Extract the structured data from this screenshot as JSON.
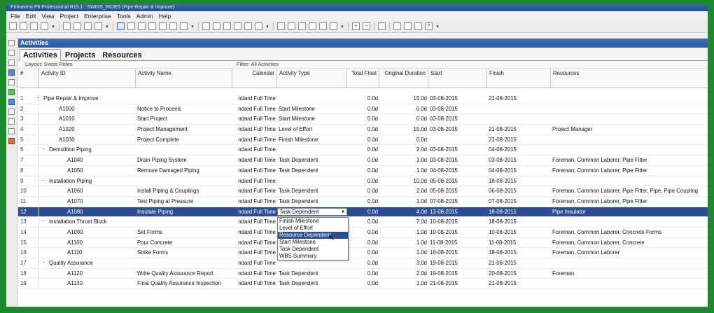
{
  "window": {
    "title": "Primavera P6 Professional R15.1 : SWISS_RIDES (Pipe Repair & Improve)"
  },
  "menu": [
    "File",
    "Edit",
    "View",
    "Project",
    "Enterprise",
    "Tools",
    "Admin",
    "Help"
  ],
  "panel_title": "Activities",
  "tabs": [
    "Activities",
    "Projects",
    "Resources"
  ],
  "layout_label": "Layout: Swiss Rides",
  "filter_label": "Filter: All Activities",
  "columns": {
    "num": "#",
    "id": "Activity ID",
    "name": "Activity Name",
    "calendar": "Calendar",
    "type": "Activity Type",
    "float": "Total Float",
    "duration": "Original Duration",
    "start": "Start",
    "finish": "Finish",
    "resources": "Resources"
  },
  "rows": [
    {
      "num": "1",
      "toggle": "−",
      "id": "Pipe Repair & Improve",
      "name": "",
      "calendar": "ndard Full Time",
      "type": "",
      "float": "0.0d",
      "duration": "15.0d",
      "start": "03-08-2015",
      "finish": "21-08-2015",
      "resources": ""
    },
    {
      "num": "2",
      "toggle": "",
      "id": "A1000",
      "name": "Notice to Proceed",
      "calendar": "ndard Full Time",
      "type": "Start Milestone",
      "float": "0.0d",
      "duration": "0.0d",
      "start": "03-08-2015",
      "finish": "",
      "resources": ""
    },
    {
      "num": "3",
      "toggle": "",
      "id": "A1010",
      "name": "Start Project",
      "calendar": "ndard Full Time",
      "type": "Start Milestone",
      "float": "0.0d",
      "duration": "0.0d",
      "start": "03-08-2015",
      "finish": "",
      "resources": ""
    },
    {
      "num": "4",
      "toggle": "",
      "id": "A1020",
      "name": "Project Management",
      "calendar": "ndard Full Time",
      "type": "Level of Effort",
      "float": "0.0d",
      "duration": "15.0d",
      "start": "03-08-2015",
      "finish": "21-08-2015",
      "resources": "Project Manager"
    },
    {
      "num": "5",
      "toggle": "",
      "id": "A1030",
      "name": "Project Complete",
      "calendar": "ndard Full Time",
      "type": "Finish Milestone",
      "float": "0.0d",
      "duration": "0.0d",
      "start": "",
      "finish": "21-08-2015",
      "resources": ""
    },
    {
      "num": "6",
      "toggle": "−",
      "id": "Demolition Piping",
      "name": "",
      "calendar": "ndard Full Time",
      "type": "",
      "float": "0.0d",
      "duration": "2.0d",
      "start": "03-08-2015",
      "finish": "04-08-2015",
      "resources": ""
    },
    {
      "num": "7",
      "toggle": "",
      "id": "A1040",
      "name": "Drain Piping System",
      "calendar": "ndard Full Time",
      "type": "Task Dependent",
      "float": "0.0d",
      "duration": "1.0d",
      "start": "03-08-2015",
      "finish": "03-08-2015",
      "resources": "Foreman, Common Laborer, Pipe Fitter"
    },
    {
      "num": "8",
      "toggle": "",
      "id": "A1050",
      "name": "Remove Damaged Piping",
      "calendar": "ndard Full Time",
      "type": "Task Dependent",
      "float": "0.0d",
      "duration": "1.0d",
      "start": "04-08-2015",
      "finish": "04-08-2015",
      "resources": "Foreman, Common Laborer, Pipe Fitter"
    },
    {
      "num": "9",
      "toggle": "−",
      "id": "Installation Piping",
      "name": "",
      "calendar": "ndard Full Time",
      "type": "",
      "float": "0.0d",
      "duration": "10.0d",
      "start": "05-08-2015",
      "finish": "18-08-2015",
      "resources": ""
    },
    {
      "num": "10",
      "toggle": "",
      "id": "A1060",
      "name": "Install Piping & Couplings",
      "calendar": "ndard Full Time",
      "type": "Task Dependent",
      "float": "0.0d",
      "duration": "2.0d",
      "start": "05-08-2015",
      "finish": "06-08-2015",
      "resources": "Foreman, Common Laborer, Pipe Fitter, Pipe, Pipe Coupling"
    },
    {
      "num": "11",
      "toggle": "",
      "id": "A1070",
      "name": "Test Piping at Pressure",
      "calendar": "ndard Full Time",
      "type": "Task Dependent",
      "float": "0.0d",
      "duration": "1.0d",
      "start": "07-08-2015",
      "finish": "07-08-2015",
      "resources": "Foreman, Common Laborer, Pipe Fitter"
    },
    {
      "num": "12",
      "toggle": "",
      "id": "A1080",
      "name": "Insulate Piping",
      "calendar": "ndard Full Time",
      "type": "Task Dependent",
      "float": "0.0d",
      "duration": "4.0d",
      "start": "13-08-2015",
      "finish": "18-08-2015",
      "resources": "Pipe Insulator",
      "selected": true
    },
    {
      "num": "13",
      "toggle": "−",
      "id": "Installation Thrust Block",
      "name": "",
      "calendar": "ndard Full Time",
      "type": "",
      "float": "0.0d",
      "duration": "7.0d",
      "start": "10-08-2015",
      "finish": "18-08-2015",
      "resources": ""
    },
    {
      "num": "14",
      "toggle": "",
      "id": "A1090",
      "name": "Set Forms",
      "calendar": "ndard Full Time",
      "type": "",
      "float": "0.0d",
      "duration": "1.0d",
      "start": "10-08-2015",
      "finish": "10-08-2015",
      "resources": "Foreman, Common Laborer, Concrete Forms"
    },
    {
      "num": "15",
      "toggle": "",
      "id": "A1100",
      "name": "Pour Concrete",
      "calendar": "ndard Full Time",
      "type": "",
      "float": "0.0d",
      "duration": "1.0d",
      "start": "11-08-2015",
      "finish": "11-08-2015",
      "resources": "Foreman, Common Laborer, Concrete"
    },
    {
      "num": "16",
      "toggle": "",
      "id": "A1110",
      "name": "Strike Forms",
      "calendar": "ndard Full Time",
      "type": "",
      "float": "0.0d",
      "duration": "1.0d",
      "start": "18-08-2015",
      "finish": "18-08-2015",
      "resources": "Foreman, Common Laborer"
    },
    {
      "num": "17",
      "toggle": "−",
      "id": "Quality Assurance",
      "name": "",
      "calendar": "ndard Full Time",
      "type": "",
      "float": "0.0d",
      "duration": "3.0d",
      "start": "19-08-2015",
      "finish": "21-08-2015",
      "resources": ""
    },
    {
      "num": "18",
      "toggle": "",
      "id": "A1120",
      "name": "Write Quality Assurance Report",
      "calendar": "ndard Full Time",
      "type": "Task Dependent",
      "float": "0.0d",
      "duration": "2.0d",
      "start": "19-08-2015",
      "finish": "20-08-2015",
      "resources": "Foreman"
    },
    {
      "num": "19",
      "toggle": "",
      "id": "A1130",
      "name": "Final Quality Assurance Inspection",
      "calendar": "ndard Full Time",
      "type": "Task Dependent",
      "float": "0.0d",
      "duration": "1.0d",
      "start": "21-08-2015",
      "finish": "21-08-2015",
      "resources": ""
    }
  ],
  "dropdown": {
    "value": "Task Dependent",
    "options": [
      "Finish Milestone",
      "Level of Effort",
      "Resource Dependent",
      "Start Milestone",
      "Task Dependent",
      "WBS Summary"
    ],
    "highlighted": "Resource Dependent"
  },
  "colors": {
    "selection": "#2b4e93",
    "header": "#2c5aa0",
    "frame": "#1c8a2e"
  }
}
